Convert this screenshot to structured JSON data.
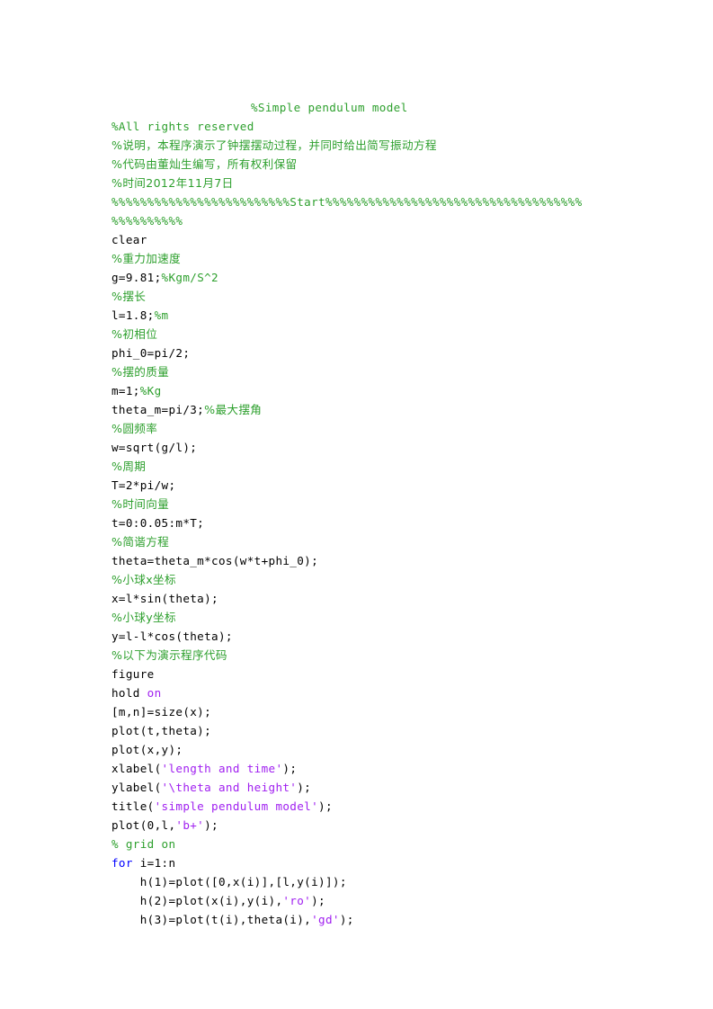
{
  "document": {
    "kind": "matlab-source-listing",
    "title_comment": "%Simple pendulum model",
    "colors": {
      "background": "#ffffff",
      "code": "#000000",
      "comment": "#2ea02e",
      "string": "#a020f0",
      "keyword": "#0000ff"
    }
  },
  "code": {
    "lines": [
      {
        "id": "l01",
        "indent": "title",
        "tokens": [
          {
            "t": "%Simple pendulum model",
            "c": "comment"
          }
        ]
      },
      {
        "id": "l02",
        "indent": "none",
        "tokens": [
          {
            "t": "%All rights reserved",
            "c": "comment"
          }
        ]
      },
      {
        "id": "l03",
        "indent": "none",
        "tokens": [
          {
            "t": "%说明，本程序演示了钟摆摆动过程，并同时给出简写振动方程",
            "c": "comment"
          }
        ]
      },
      {
        "id": "l04",
        "indent": "none",
        "tokens": [
          {
            "t": "%代码由董灿生编写，所有权利保留",
            "c": "comment"
          }
        ]
      },
      {
        "id": "l05",
        "indent": "none",
        "tokens": [
          {
            "t": "%时间2012年11月7日",
            "c": "comment"
          }
        ]
      },
      {
        "id": "l06",
        "indent": "none",
        "tokens": [
          {
            "t": "%%%%%%%%%%%%%%%%%%%%%%%%%Start%%%%%%%%%%%%%%%%%%%%%%%%%%%%%%%%%%%%",
            "c": "comment"
          }
        ]
      },
      {
        "id": "l07",
        "indent": "none",
        "tokens": [
          {
            "t": "%%%%%%%%%%",
            "c": "comment"
          }
        ]
      },
      {
        "id": "l08",
        "indent": "none",
        "tokens": [
          {
            "t": "clear",
            "c": "plain"
          }
        ]
      },
      {
        "id": "l09",
        "indent": "none",
        "tokens": [
          {
            "t": "%重力加速度",
            "c": "comment"
          }
        ]
      },
      {
        "id": "l10",
        "indent": "none",
        "tokens": [
          {
            "t": "g=9.81;",
            "c": "plain"
          },
          {
            "t": "%Kgm/S^2",
            "c": "comment"
          }
        ]
      },
      {
        "id": "l11",
        "indent": "none",
        "tokens": [
          {
            "t": "%摆长",
            "c": "comment"
          }
        ]
      },
      {
        "id": "l12",
        "indent": "none",
        "tokens": [
          {
            "t": "l=1.8;",
            "c": "plain"
          },
          {
            "t": "%m",
            "c": "comment"
          }
        ]
      },
      {
        "id": "l13",
        "indent": "none",
        "tokens": [
          {
            "t": "%初相位",
            "c": "comment"
          }
        ]
      },
      {
        "id": "l14",
        "indent": "none",
        "tokens": [
          {
            "t": "phi_0=pi/2;",
            "c": "plain"
          }
        ]
      },
      {
        "id": "l15",
        "indent": "none",
        "tokens": [
          {
            "t": "%摆的质量",
            "c": "comment"
          }
        ]
      },
      {
        "id": "l16",
        "indent": "none",
        "tokens": [
          {
            "t": "m=1;",
            "c": "plain"
          },
          {
            "t": "%Kg",
            "c": "comment"
          }
        ]
      },
      {
        "id": "l17",
        "indent": "none",
        "tokens": [
          {
            "t": "theta_m=pi/3;",
            "c": "plain"
          },
          {
            "t": "%最大摆角",
            "c": "comment"
          }
        ]
      },
      {
        "id": "l18",
        "indent": "none",
        "tokens": [
          {
            "t": "%圆频率",
            "c": "comment"
          }
        ]
      },
      {
        "id": "l19",
        "indent": "none",
        "tokens": [
          {
            "t": "w=sqrt(g/l);",
            "c": "plain"
          }
        ]
      },
      {
        "id": "l20",
        "indent": "none",
        "tokens": [
          {
            "t": "%周期",
            "c": "comment"
          }
        ]
      },
      {
        "id": "l21",
        "indent": "none",
        "tokens": [
          {
            "t": "T=2*pi/w;",
            "c": "plain"
          }
        ]
      },
      {
        "id": "l22",
        "indent": "none",
        "tokens": [
          {
            "t": "%时间向量",
            "c": "comment"
          }
        ]
      },
      {
        "id": "l23",
        "indent": "none",
        "tokens": [
          {
            "t": "t=0:0.05:m*T;",
            "c": "plain"
          }
        ]
      },
      {
        "id": "l24",
        "indent": "none",
        "tokens": [
          {
            "t": "%简谐方程",
            "c": "comment"
          }
        ]
      },
      {
        "id": "l25",
        "indent": "none",
        "tokens": [
          {
            "t": "theta=theta_m*cos(w*t+phi_0);",
            "c": "plain"
          }
        ]
      },
      {
        "id": "l26",
        "indent": "none",
        "tokens": [
          {
            "t": "%小球x坐标",
            "c": "comment"
          }
        ]
      },
      {
        "id": "l27",
        "indent": "none",
        "tokens": [
          {
            "t": "x=l*sin(theta);",
            "c": "plain"
          }
        ]
      },
      {
        "id": "l28",
        "indent": "none",
        "tokens": [
          {
            "t": "%小球y坐标",
            "c": "comment"
          }
        ]
      },
      {
        "id": "l29",
        "indent": "none",
        "tokens": [
          {
            "t": "y=l-l*cos(theta);",
            "c": "plain"
          }
        ]
      },
      {
        "id": "l30",
        "indent": "none",
        "tokens": [
          {
            "t": "%以下为演示程序代码",
            "c": "comment"
          }
        ]
      },
      {
        "id": "l31",
        "indent": "none",
        "tokens": [
          {
            "t": "figure",
            "c": "plain"
          }
        ]
      },
      {
        "id": "l32",
        "indent": "none",
        "tokens": [
          {
            "t": "hold ",
            "c": "plain"
          },
          {
            "t": "on",
            "c": "kw-mag"
          }
        ]
      },
      {
        "id": "l33",
        "indent": "none",
        "tokens": [
          {
            "t": "[m,n]=size(x);",
            "c": "plain"
          }
        ]
      },
      {
        "id": "l34",
        "indent": "none",
        "tokens": [
          {
            "t": "plot(t,theta);",
            "c": "plain"
          }
        ]
      },
      {
        "id": "l35",
        "indent": "none",
        "tokens": [
          {
            "t": "plot(x,y);",
            "c": "plain"
          }
        ]
      },
      {
        "id": "l36",
        "indent": "none",
        "tokens": [
          {
            "t": "xlabel(",
            "c": "plain"
          },
          {
            "t": "'length and time'",
            "c": "string"
          },
          {
            "t": ");",
            "c": "plain"
          }
        ]
      },
      {
        "id": "l37",
        "indent": "none",
        "tokens": [
          {
            "t": "ylabel(",
            "c": "plain"
          },
          {
            "t": "'\\theta and height'",
            "c": "string"
          },
          {
            "t": ");",
            "c": "plain"
          }
        ]
      },
      {
        "id": "l38",
        "indent": "none",
        "tokens": [
          {
            "t": "title(",
            "c": "plain"
          },
          {
            "t": "'simple pendulum model'",
            "c": "string"
          },
          {
            "t": ");",
            "c": "plain"
          }
        ]
      },
      {
        "id": "l39",
        "indent": "none",
        "tokens": [
          {
            "t": "plot(0,l,",
            "c": "plain"
          },
          {
            "t": "'b+'",
            "c": "string"
          },
          {
            "t": ");",
            "c": "plain"
          }
        ]
      },
      {
        "id": "l40",
        "indent": "none",
        "tokens": [
          {
            "t": "% grid on",
            "c": "comment"
          }
        ]
      },
      {
        "id": "l41",
        "indent": "none",
        "tokens": [
          {
            "t": "for",
            "c": "keyword"
          },
          {
            "t": " i=1:n",
            "c": "plain"
          }
        ]
      },
      {
        "id": "l42",
        "indent": "none",
        "tokens": [
          {
            "t": "    h(1)=plot([0,x(i)],[l,y(i)]);",
            "c": "plain"
          }
        ]
      },
      {
        "id": "l43",
        "indent": "none",
        "tokens": [
          {
            "t": "    h(2)=plot(x(i),y(i),",
            "c": "plain"
          },
          {
            "t": "'ro'",
            "c": "string"
          },
          {
            "t": ");",
            "c": "plain"
          }
        ]
      },
      {
        "id": "l44",
        "indent": "none",
        "tokens": [
          {
            "t": "    h(3)=plot(t(i),theta(i),",
            "c": "plain"
          },
          {
            "t": "'gd'",
            "c": "string"
          },
          {
            "t": ");",
            "c": "plain"
          }
        ]
      }
    ]
  }
}
